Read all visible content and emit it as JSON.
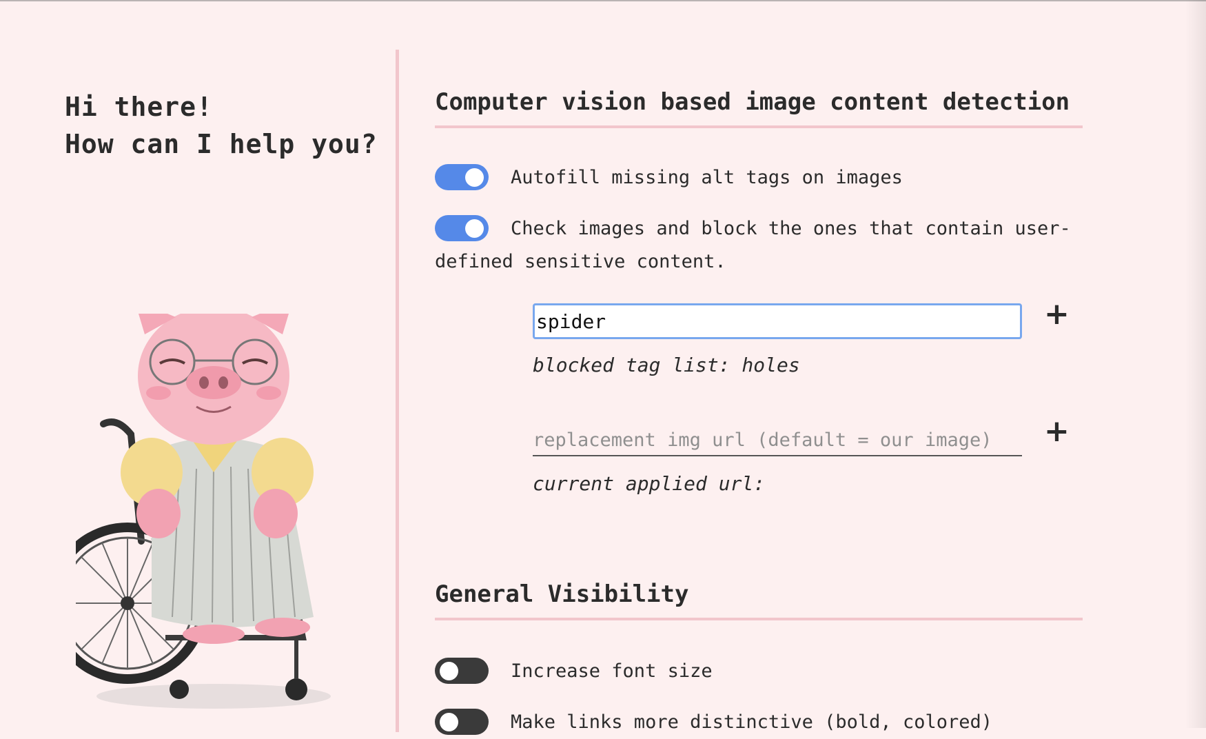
{
  "greeting": {
    "line1": "Hi there!",
    "line2": "How can I help you?"
  },
  "illustration": {
    "subject": "pig with glasses in wheelchair"
  },
  "image_detection": {
    "title": "Computer vision based image content detection",
    "autofill_label": "Autofill missing alt tags on images",
    "autofill_on": true,
    "block_label": "Check images and block the ones that contain user-defined sensitive content.",
    "block_on": true,
    "tag_input_value": "spider",
    "blocked_list_text": "blocked tag list: holes",
    "replacement_placeholder": "replacement img url (default = our image)",
    "current_url_text": "current applied url:",
    "add_symbol": "+"
  },
  "general_visibility": {
    "title": "General Visibility",
    "increase_font_label": "Increase font size",
    "increase_font_on": false,
    "links_label": "Make links more distinctive (bold, colored)",
    "links_on": false
  },
  "colors": {
    "background": "#fdf0f0",
    "accent_pink": "#f2c6cc",
    "toggle_on": "#5589e8",
    "toggle_off": "#3a3a3a"
  }
}
